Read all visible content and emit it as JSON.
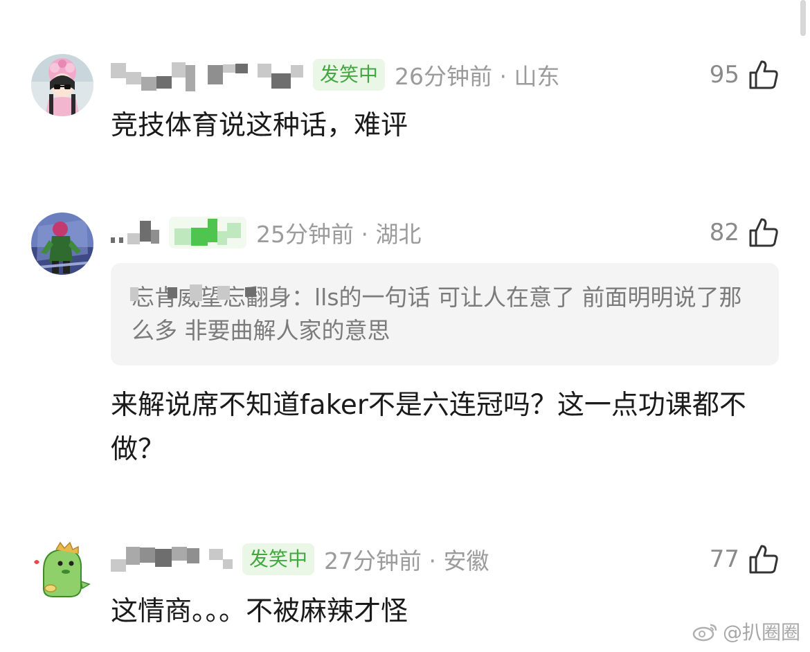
{
  "comments": [
    {
      "badge": "发笑中",
      "time_location": "26分钟前 · 山东",
      "likes": "95",
      "text": "竞技体育说这种话，难评"
    },
    {
      "time_location": "25分钟前 · 湖北",
      "likes": "82",
      "quote": "忘肯威望忘翻身：lls的一句话 可让人在意了  前面明明说了那么多 非要曲解人家的意思",
      "text": "来解说席不知道faker不是六连冠吗？这一点功课都不做？"
    },
    {
      "badge": "发笑中",
      "time_location": "27分钟前 · 安徽",
      "likes": "77",
      "text": "这情商。。。不被麻辣才怪"
    }
  ],
  "watermark": {
    "text": "@扒圈圈",
    "icon": "weibo-icon"
  },
  "colors": {
    "badge_bg": "#eaf7e6",
    "badge_text": "#43a740",
    "meta_text": "#9b9b9b",
    "quote_bg": "#f4f4f4"
  }
}
